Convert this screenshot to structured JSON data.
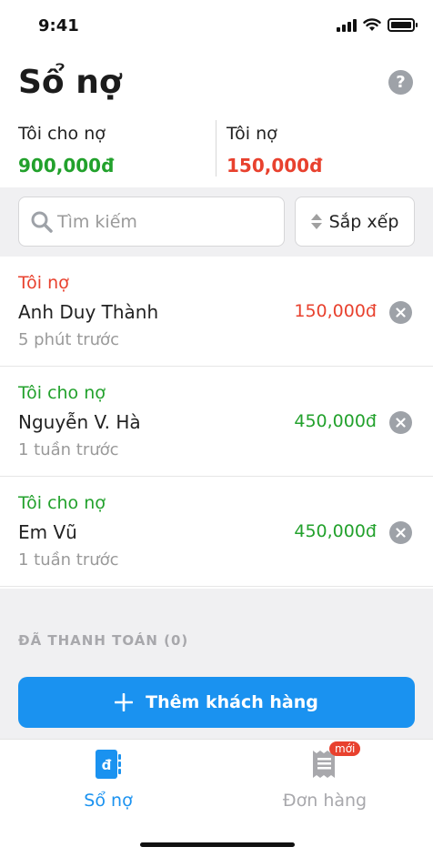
{
  "status_bar": {
    "time": "9:41"
  },
  "header": {
    "title": "Sổ nợ",
    "help_icon": "?"
  },
  "summary": {
    "lent_label": "Tôi cho nợ",
    "lent_amount": "900,000đ",
    "owe_label": "Tôi nợ",
    "owe_amount": "150,000đ"
  },
  "search": {
    "placeholder": "Tìm kiếm"
  },
  "sort": {
    "label": "Sắp xếp"
  },
  "debts": [
    {
      "type": "Tôi nợ",
      "name": "Anh Duy Thành",
      "time": "5 phút trước",
      "amount": "150,000đ",
      "kind": "owe"
    },
    {
      "type": "Tôi cho nợ",
      "name": "Nguyễn V. Hà",
      "time": "1 tuần trước",
      "amount": "450,000đ",
      "kind": "lent"
    },
    {
      "type": "Tôi cho nợ",
      "name": "Em Vũ",
      "time": "1 tuần trước",
      "amount": "450,000đ",
      "kind": "lent"
    }
  ],
  "paid_section": {
    "label": "ĐÃ THANH TOÁN (0)"
  },
  "add_button": {
    "label": "Thêm khách hàng"
  },
  "tabs": [
    {
      "label": "Sổ nợ",
      "icon": "ledger-icon",
      "glyph": "đ",
      "active": true
    },
    {
      "label": "Đơn hàng",
      "icon": "receipt-icon",
      "badge": "mới",
      "active": false
    }
  ],
  "colors": {
    "lent": "#22a12c",
    "owe": "#e8412e",
    "accent": "#1a92f0",
    "inactive": "#a8a8ac"
  }
}
